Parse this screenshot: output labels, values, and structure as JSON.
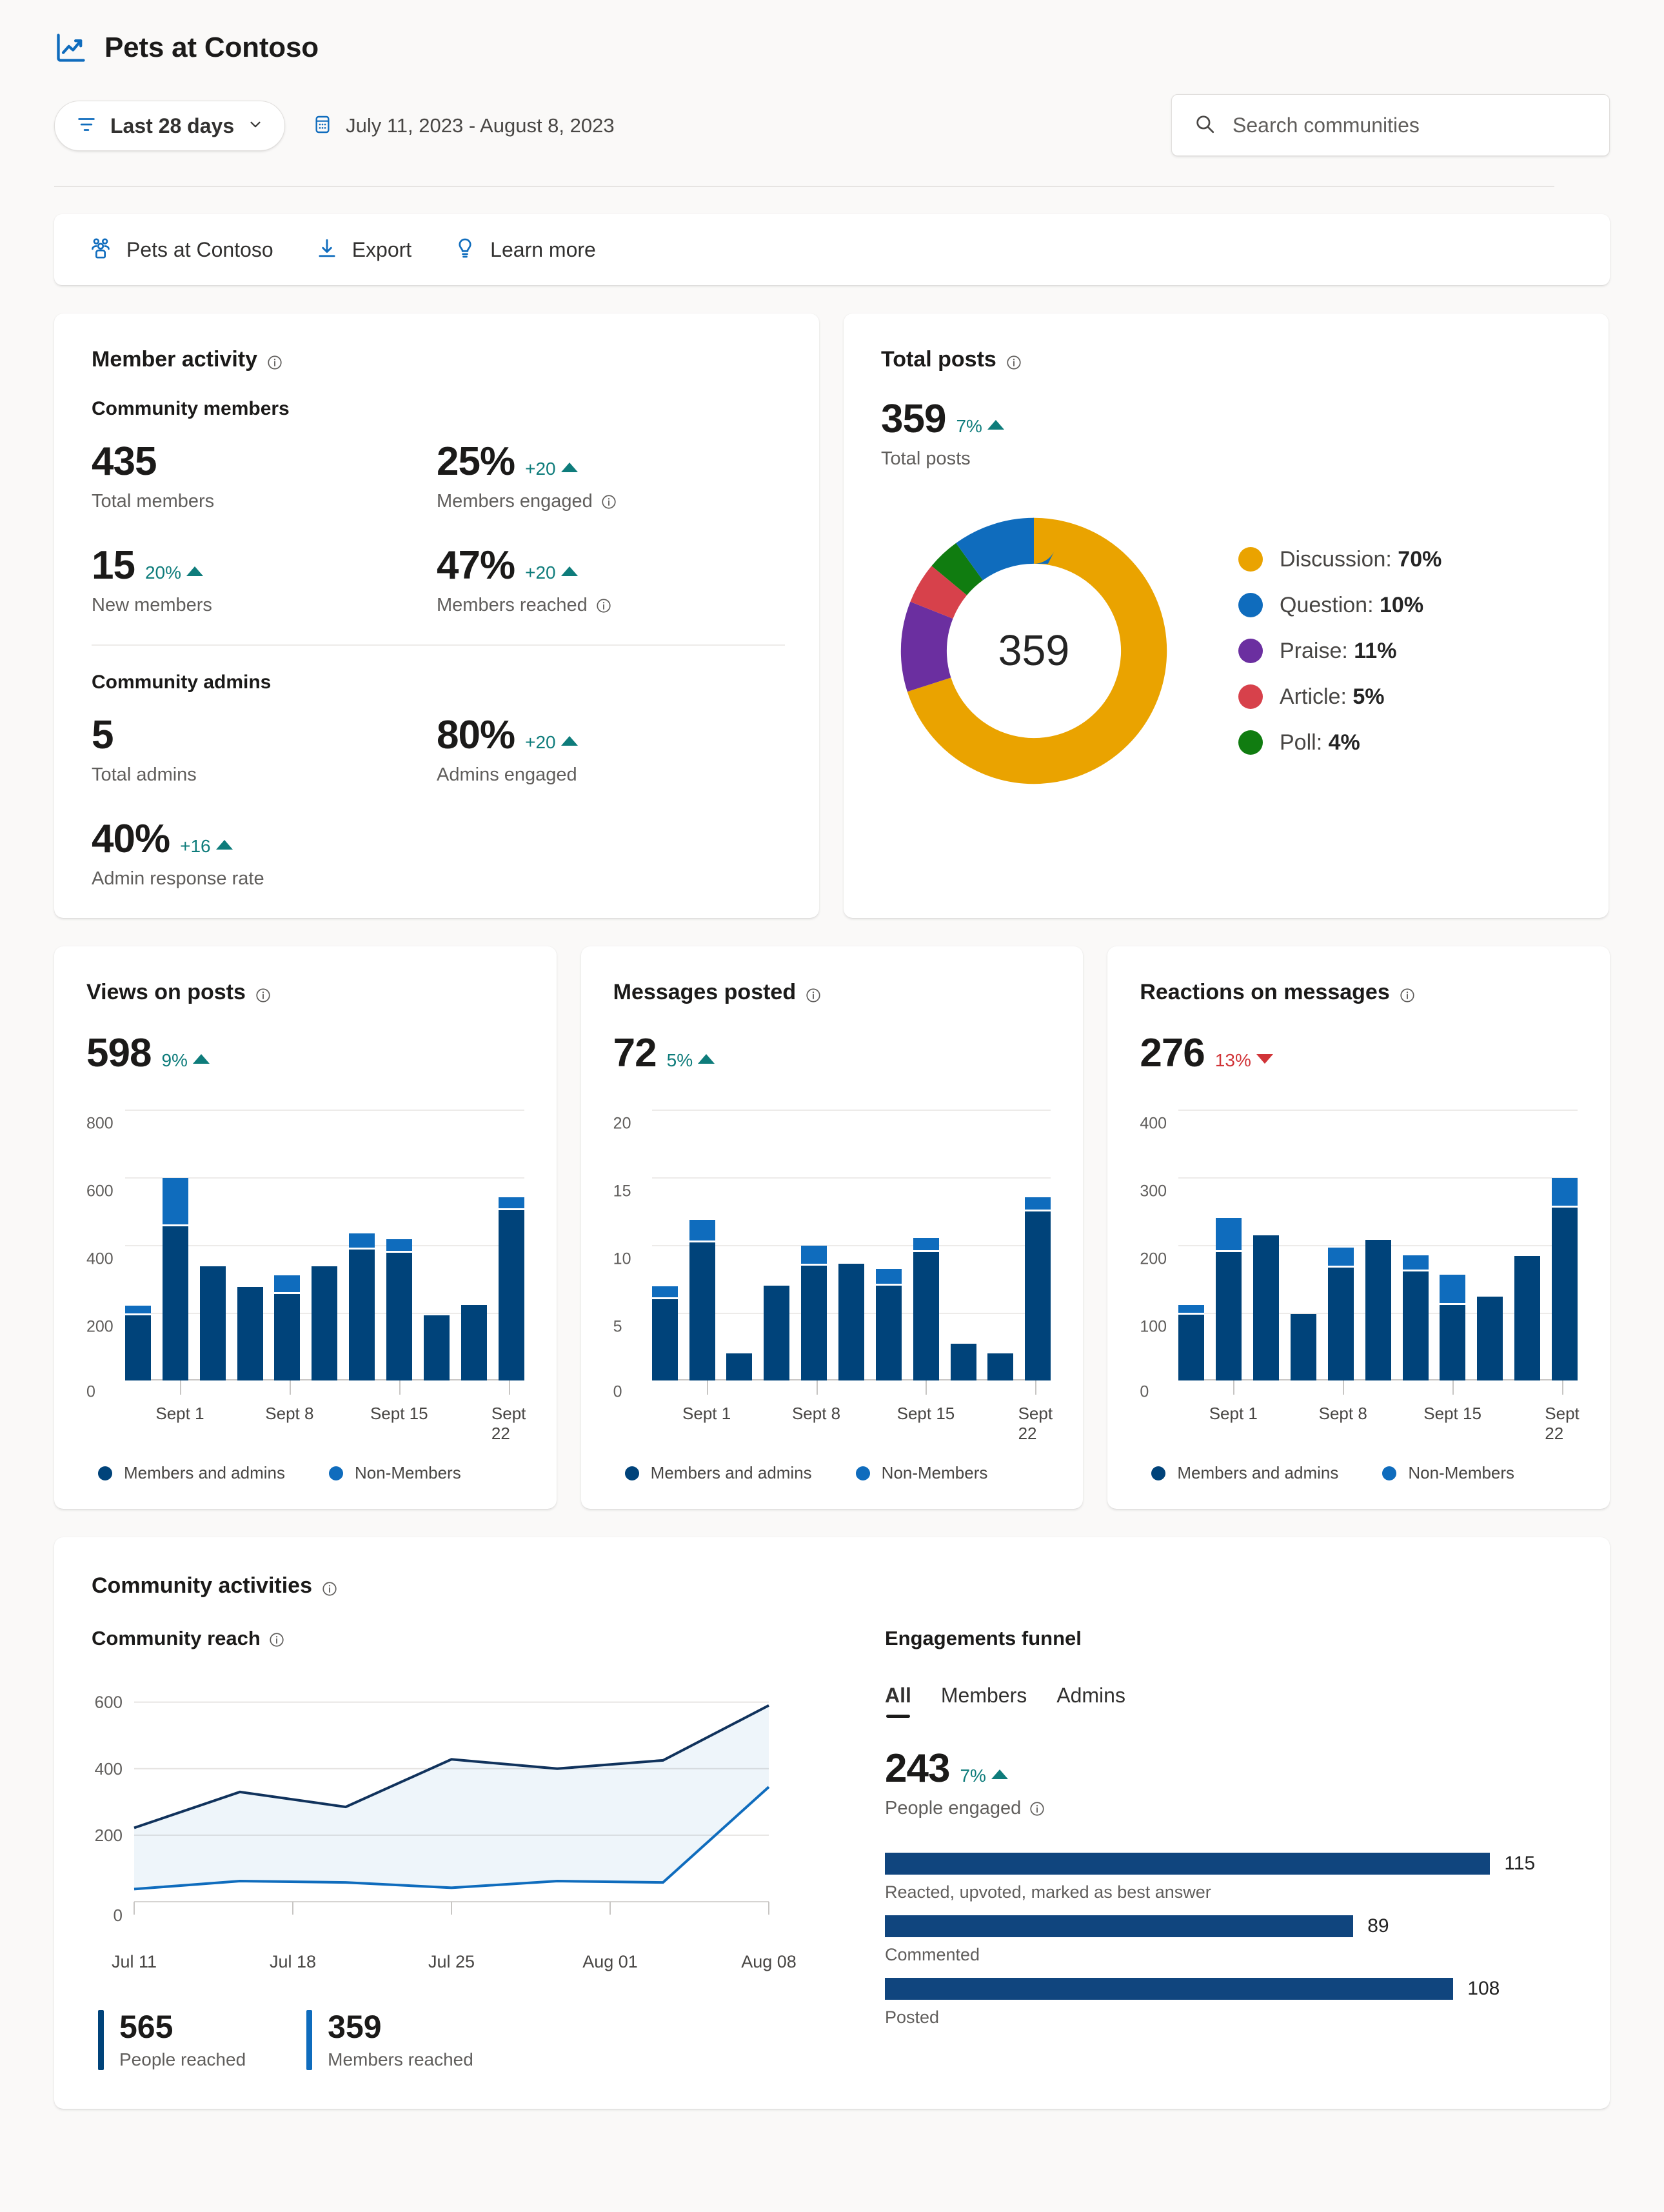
{
  "app": {
    "title": "Pets at Contoso",
    "logo_icon": "analytics-chart-icon"
  },
  "controls": {
    "date_filter_label": "Last 28 days",
    "filter_icon": "filter-icon",
    "chevron_icon": "chevron-down-icon",
    "calendar_icon": "calendar-icon",
    "date_range": "July 11, 2023 - August 8, 2023"
  },
  "search": {
    "placeholder": "Search communities",
    "icon": "search-icon"
  },
  "toolbar": {
    "items": [
      {
        "label": "Pets at Contoso",
        "icon": "people-community-icon"
      },
      {
        "label": "Export",
        "icon": "download-arrow-icon"
      },
      {
        "label": "Learn more",
        "icon": "lightbulb-icon"
      }
    ]
  },
  "member_activity": {
    "title": "Member activity",
    "info_icon": "info-icon",
    "members_section_label": "Community members",
    "admins_section_label": "Community admins",
    "metrics": [
      {
        "value": "435",
        "delta": "",
        "trend": "none",
        "label": "Total members",
        "has_info": false
      },
      {
        "value": "25%",
        "delta": "+20",
        "trend": "up",
        "label": "Members engaged",
        "has_info": true
      },
      {
        "value": "15",
        "delta": "20%",
        "trend": "up",
        "label": "New members",
        "has_info": false
      },
      {
        "value": "47%",
        "delta": "+20",
        "trend": "up",
        "label": "Members reached",
        "has_info": true
      }
    ],
    "admin_metrics": [
      {
        "value": "5",
        "delta": "",
        "trend": "none",
        "label": "Total admins",
        "has_info": false
      },
      {
        "value": "80%",
        "delta": "+20",
        "trend": "up",
        "label": "Admins engaged",
        "has_info": false
      },
      {
        "value": "40%",
        "delta": "+16",
        "trend": "up",
        "label": "Admin response rate",
        "has_info": false
      }
    ]
  },
  "total_posts": {
    "title": "Total posts",
    "info_icon": "info-icon",
    "value": "359",
    "delta": "7%",
    "trend": "up",
    "label": "Total posts",
    "center_value": "359"
  },
  "bar_cards": [
    {
      "id": "views-on-posts",
      "title": "Views on posts",
      "value": "598",
      "delta": "9%",
      "trend": "up",
      "legend": [
        {
          "label": "Members and admins",
          "color": "#00437a"
        },
        {
          "label": "Non-Members",
          "color": "#0f6cbd"
        }
      ]
    },
    {
      "id": "messages-posted",
      "title": "Messages posted",
      "value": "72",
      "delta": "5%",
      "trend": "up",
      "legend": [
        {
          "label": "Members and admins",
          "color": "#00437a"
        },
        {
          "label": "Non-Members",
          "color": "#0f6cbd"
        }
      ]
    },
    {
      "id": "reactions-on-messages",
      "title": "Reactions on messages",
      "value": "276",
      "delta": "13%",
      "trend": "down",
      "legend": [
        {
          "label": "Members and admins",
          "color": "#00437a"
        },
        {
          "label": "Non-Members",
          "color": "#0f6cbd"
        }
      ]
    }
  ],
  "activities": {
    "title": "Community activities",
    "reach_title": "Community reach",
    "funnel_title": "Engagements funnel",
    "tabs": [
      {
        "label": "All",
        "active": true
      },
      {
        "label": "Members",
        "active": false
      },
      {
        "label": "Admins",
        "active": false
      }
    ],
    "engaged_value": "243",
    "engaged_delta": "7%",
    "engaged_trend": "up",
    "engaged_label": "People engaged",
    "stats": [
      {
        "value": "565",
        "label": "People reached",
        "color": "#00437a"
      },
      {
        "value": "359",
        "label": "Members reached",
        "color": "#0f6cbd"
      }
    ]
  },
  "chart_data": [
    {
      "id": "total-posts-donut",
      "type": "pie",
      "title": "Total posts",
      "center_label": "359",
      "total": 359,
      "legend_position": "right",
      "categories": [
        "Discussion",
        "Question",
        "Praise",
        "Article",
        "Poll"
      ],
      "values": [
        70.0,
        10.0,
        11.0,
        5.0,
        4.0
      ],
      "labels": [
        "Discussion: 70.0%",
        "Question: 10.0%",
        "Praise: 11.0%",
        "Article: 5.0%",
        "Poll: 4.0%"
      ],
      "colors": [
        "#eaa300",
        "#0f6cbd",
        "#6b2fa0",
        "#d7414b",
        "#107c10"
      ],
      "draw_order": [
        "Discussion",
        "Praise",
        "Article",
        "Poll",
        "Question"
      ]
    },
    {
      "id": "views-on-posts",
      "type": "bar",
      "stacked": true,
      "title": "Views on posts",
      "total": 598,
      "change": "9%",
      "trend": "up",
      "ylabel": "",
      "xlabel": "",
      "ylim": [
        0,
        800
      ],
      "yticks": [
        0,
        200,
        400,
        600,
        800
      ],
      "grid": true,
      "x_tick_labels": [
        "Sept 1",
        "Sept 8",
        "Sept 15",
        "Sept 22"
      ],
      "x_tick_positions": [
        1,
        4,
        7,
        10
      ],
      "categories": [
        "d1",
        "d2",
        "d3",
        "d4",
        "d5",
        "d6",
        "d7",
        "d8",
        "d9",
        "d10",
        "d11"
      ],
      "series": [
        {
          "name": "Members and admins",
          "color": "#00437a",
          "values": [
            192,
            455,
            338,
            277,
            255,
            338,
            387,
            378,
            192,
            222,
            503
          ]
        },
        {
          "name": "Non-Members",
          "color": "#0f6cbd",
          "values": [
            23,
            137,
            0,
            0,
            50,
            0,
            42,
            33,
            0,
            0,
            32
          ]
        }
      ],
      "legend": [
        "Members and admins",
        "Non-Members"
      ]
    },
    {
      "id": "messages-posted",
      "type": "bar",
      "stacked": true,
      "title": "Messages posted",
      "total": 72,
      "change": "5%",
      "trend": "up",
      "ylabel": "",
      "xlabel": "",
      "ylim": [
        0,
        20
      ],
      "yticks": [
        0,
        5,
        10,
        15,
        20
      ],
      "grid": true,
      "x_tick_labels": [
        "Sept 1",
        "Sept 8",
        "Sept 15",
        "Sept 22"
      ],
      "x_tick_positions": [
        1,
        4,
        7,
        10
      ],
      "categories": [
        "d1",
        "d2",
        "d3",
        "d4",
        "d5",
        "d6",
        "d7",
        "d8",
        "d9",
        "d10",
        "d11"
      ],
      "series": [
        {
          "name": "Members and admins",
          "color": "#00437a",
          "values": [
            6.0,
            10.2,
            2.0,
            7.0,
            8.5,
            8.6,
            7.0,
            9.5,
            2.7,
            2.0,
            12.5
          ]
        },
        {
          "name": "Non-Members",
          "color": "#0f6cbd",
          "values": [
            0.8,
            1.5,
            0,
            0,
            1.3,
            0,
            1.1,
            0.9,
            0,
            0,
            0.9
          ]
        }
      ],
      "legend": [
        "Members and admins",
        "Non-Members"
      ]
    },
    {
      "id": "reactions-on-messages",
      "type": "bar",
      "stacked": true,
      "title": "Reactions on messages",
      "total": 276,
      "change": "13%",
      "trend": "down",
      "ylabel": "",
      "xlabel": "",
      "ylim": [
        0,
        400
      ],
      "yticks": [
        0,
        100,
        200,
        300,
        400
      ],
      "grid": true,
      "x_tick_labels": [
        "Sept 1",
        "Sept 8",
        "Sept 15",
        "Sept 22"
      ],
      "x_tick_positions": [
        1,
        4,
        7,
        10
      ],
      "categories": [
        "d1",
        "d2",
        "d3",
        "d4",
        "d5",
        "d6",
        "d7",
        "d8",
        "d9",
        "d10",
        "d11"
      ],
      "series": [
        {
          "name": "Members and admins",
          "color": "#00437a",
          "values": [
            97,
            190,
            214,
            98,
            167,
            208,
            161,
            111,
            124,
            184,
            255
          ]
        },
        {
          "name": "Non-Members",
          "color": "#0f6cbd",
          "values": [
            12,
            47,
            0,
            0,
            26,
            0,
            21,
            42,
            0,
            0,
            41
          ]
        }
      ],
      "legend": [
        "Members and admins",
        "Non-Members"
      ]
    },
    {
      "id": "community-reach",
      "type": "area",
      "title": "Community reach",
      "ylim": [
        0,
        640
      ],
      "yticks": [
        0,
        200,
        400,
        600
      ],
      "grid": true,
      "x": [
        "Jul 11",
        "",
        "Jul 18",
        "",
        "Jul 25",
        "",
        "Aug 01",
        "",
        "Aug 08"
      ],
      "x_tick_labels": [
        "Jul 11",
        "Jul 18",
        "Jul 25",
        "Aug 01",
        "Aug 08"
      ],
      "series": [
        {
          "name": "People reached",
          "color": "#10325c",
          "values": [
            222,
            330,
            285,
            428,
            400,
            425,
            590
          ]
        },
        {
          "name": "Members reached",
          "color": "#0f6cbd",
          "values": [
            38,
            62,
            58,
            42,
            62,
            58,
            345
          ]
        }
      ]
    },
    {
      "id": "engagements-funnel",
      "type": "bar",
      "orientation": "horizontal",
      "title": "Engagements funnel",
      "categories": [
        "Reacted, upvoted, marked as best answer",
        "Commented",
        "Posted"
      ],
      "values": [
        115,
        89,
        108
      ],
      "max": 125,
      "color": "#10457e"
    }
  ]
}
